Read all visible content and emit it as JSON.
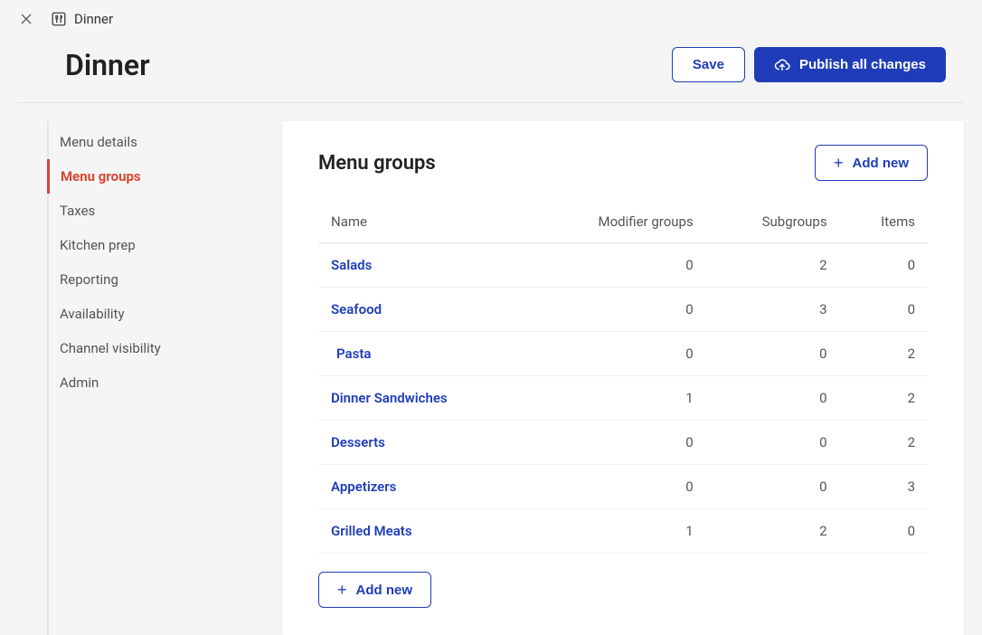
{
  "topbar": {
    "breadcrumb_label": "Dinner"
  },
  "header": {
    "title": "Dinner",
    "save_label": "Save",
    "publish_label": "Publish all changes"
  },
  "sidebar": {
    "items": [
      {
        "label": "Menu details",
        "active": false
      },
      {
        "label": "Menu groups",
        "active": true
      },
      {
        "label": "Taxes",
        "active": false
      },
      {
        "label": "Kitchen prep",
        "active": false
      },
      {
        "label": "Reporting",
        "active": false
      },
      {
        "label": "Availability",
        "active": false
      },
      {
        "label": "Channel visibility",
        "active": false
      },
      {
        "label": "Admin",
        "active": false
      }
    ]
  },
  "panel": {
    "title": "Menu groups",
    "add_new_label": "Add new",
    "columns": {
      "name": "Name",
      "modifier_groups": "Modifier groups",
      "subgroups": "Subgroups",
      "items": "Items"
    },
    "rows": [
      {
        "name": "Salads",
        "modifier_groups": 0,
        "subgroups": 2,
        "items": 0,
        "indent": false
      },
      {
        "name": "Seafood",
        "modifier_groups": 0,
        "subgroups": 3,
        "items": 0,
        "indent": false
      },
      {
        "name": "Pasta",
        "modifier_groups": 0,
        "subgroups": 0,
        "items": 2,
        "indent": true
      },
      {
        "name": "Dinner Sandwiches",
        "modifier_groups": 1,
        "subgroups": 0,
        "items": 2,
        "indent": false
      },
      {
        "name": "Desserts",
        "modifier_groups": 0,
        "subgroups": 0,
        "items": 2,
        "indent": false
      },
      {
        "name": "Appetizers",
        "modifier_groups": 0,
        "subgroups": 0,
        "items": 3,
        "indent": false
      },
      {
        "name": "Grilled Meats",
        "modifier_groups": 1,
        "subgroups": 2,
        "items": 0,
        "indent": false
      }
    ]
  }
}
